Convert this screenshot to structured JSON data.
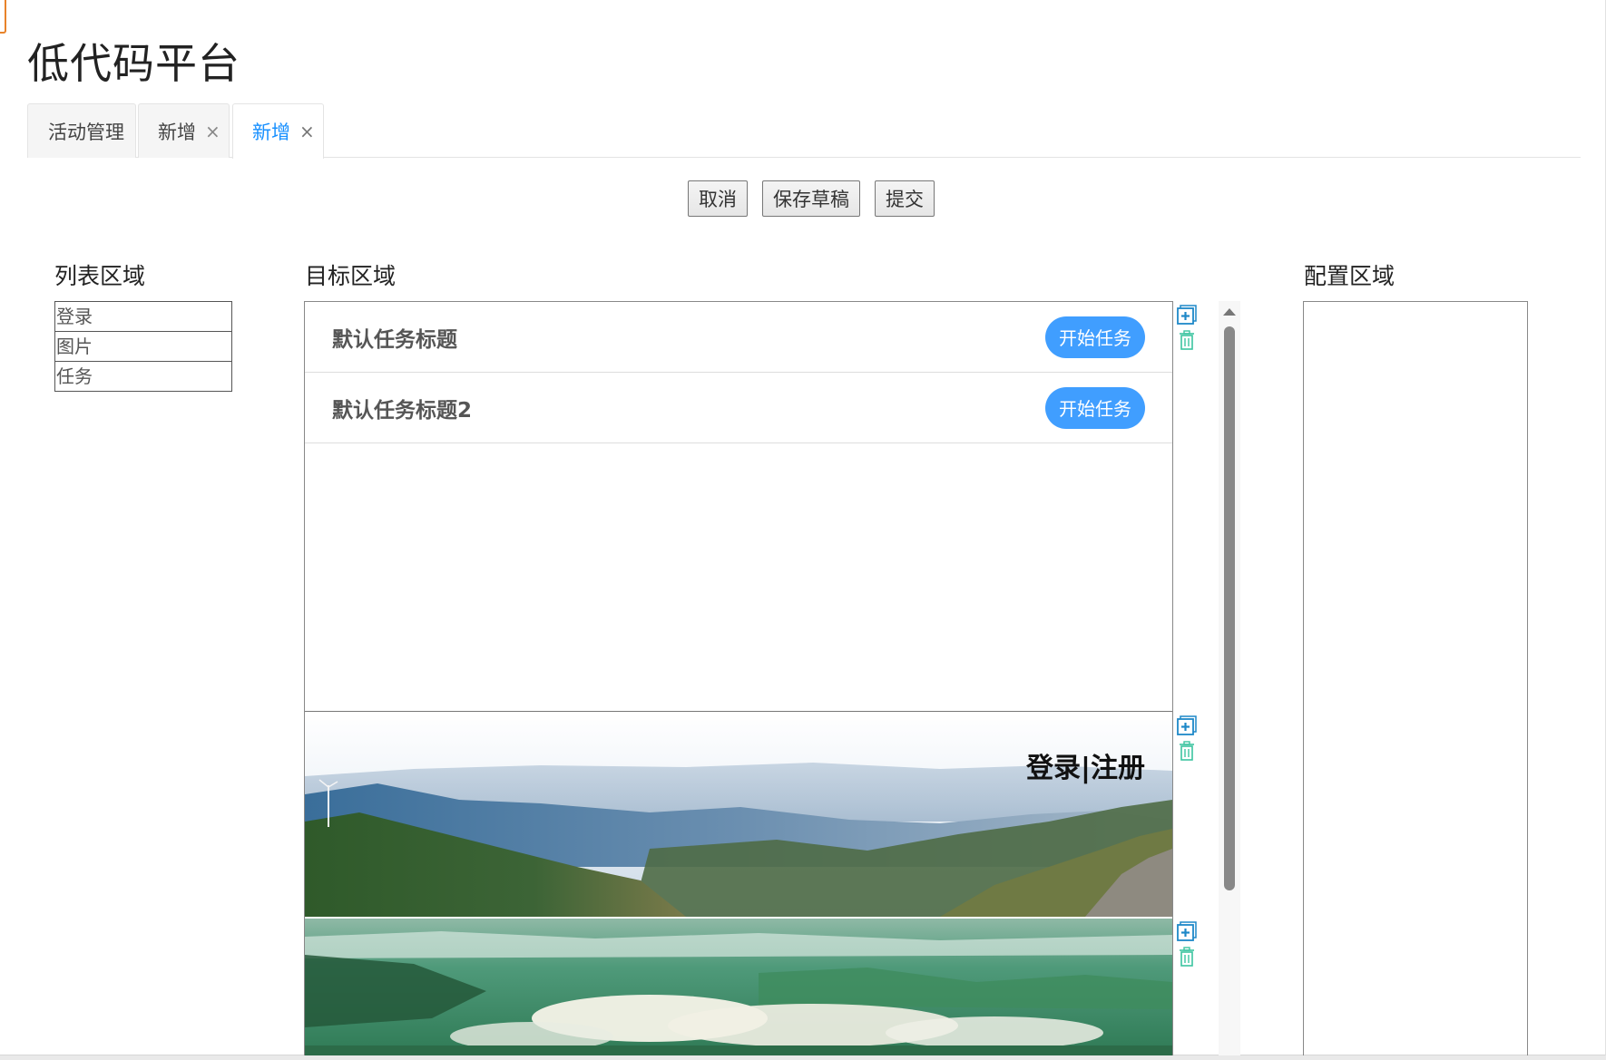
{
  "app_title": "低代码平台",
  "tabs": [
    {
      "label": "活动管理",
      "closable": false,
      "active": false
    },
    {
      "label": "新增",
      "closable": true,
      "close_glyph": "×",
      "active": false
    },
    {
      "label": "新增",
      "closable": true,
      "close_glyph": "×",
      "active": true
    }
  ],
  "toolbar": {
    "cancel_label": "取消",
    "save_draft_label": "保存草稿",
    "submit_label": "提交"
  },
  "list_area": {
    "title": "列表区域",
    "items": [
      "登录",
      "图片",
      "任务"
    ]
  },
  "target_area": {
    "title": "目标区域",
    "tasks": [
      {
        "title": "默认任务标题",
        "button_label": "开始任务"
      },
      {
        "title": "默认任务标题2",
        "button_label": "开始任务"
      }
    ],
    "login_block": {
      "link_text": "登录|注册"
    },
    "controls": {
      "add_icon": "add-square-icon",
      "delete_icon": "trash-icon"
    }
  },
  "config_area": {
    "title": "配置区域"
  },
  "colors": {
    "accent": "#1890ff",
    "task_button": "#409eff",
    "control_icon": "#1e88c8",
    "delete_icon": "#3cc4a0"
  }
}
